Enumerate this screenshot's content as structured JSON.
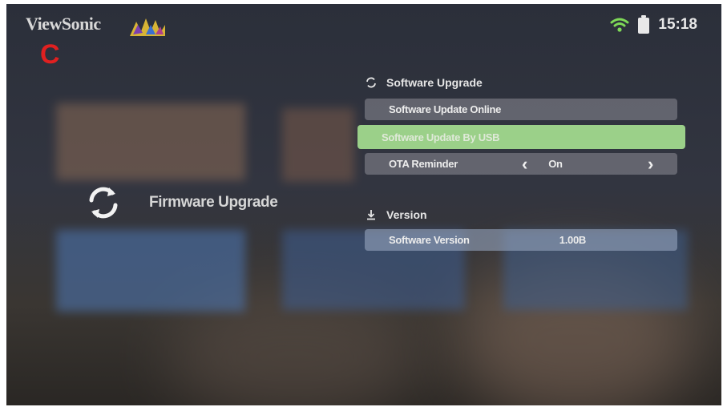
{
  "brand": {
    "name": "ViewSonic",
    "marker_letter": "C"
  },
  "status": {
    "wifi_icon": "wifi-icon",
    "battery_icon": "battery-icon",
    "time": "15:18"
  },
  "left": {
    "firmware_icon": "sync-icon",
    "firmware_label": "Firmware Upgrade"
  },
  "software_upgrade": {
    "title": "Software Upgrade",
    "icon": "sync-icon",
    "update_online": "Software Update Online",
    "update_usb": "Software Update By USB",
    "ota_label": "OTA Reminder",
    "ota_value": "On"
  },
  "version": {
    "title": "Version",
    "icon": "download-icon",
    "software_version_label": "Software Version",
    "software_version_value": "1.00B"
  },
  "colors": {
    "selected": "#9bd089",
    "marker": "#e02020"
  }
}
